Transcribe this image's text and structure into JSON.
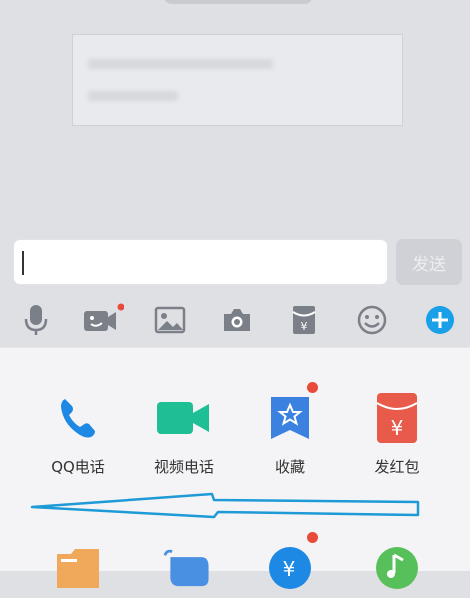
{
  "chat": {
    "top_pill": "",
    "message_blurred": true
  },
  "input": {
    "value": "",
    "placeholder": "",
    "send_label": "发送"
  },
  "toolbar": {
    "items": [
      "microphone-icon",
      "video-message-icon",
      "image-icon",
      "camera-icon",
      "red-envelope-icon",
      "emoji-icon",
      "plus-icon"
    ],
    "accent": "#1aa0e8"
  },
  "panel": {
    "row1": [
      {
        "label": "QQ电话",
        "icon": "phone-icon",
        "color": "#1e88e5",
        "badge": false
      },
      {
        "label": "视频电话",
        "icon": "video-call-icon",
        "color": "#1fbf96",
        "badge": false
      },
      {
        "label": "收藏",
        "icon": "favorite-icon",
        "color": "#3b82e0",
        "badge": true
      },
      {
        "label": "发红包",
        "icon": "red-packet-icon",
        "color": "#e85b4a",
        "badge": false
      }
    ],
    "row2": [
      {
        "icon": "folder-icon",
        "color": "#f0a95a"
      },
      {
        "icon": "poke-icon",
        "color": "#4a90e2"
      },
      {
        "icon": "transfer-icon",
        "color": "#1e88e5",
        "badge": true
      },
      {
        "icon": "music-icon",
        "color": "#58c05a"
      }
    ]
  }
}
